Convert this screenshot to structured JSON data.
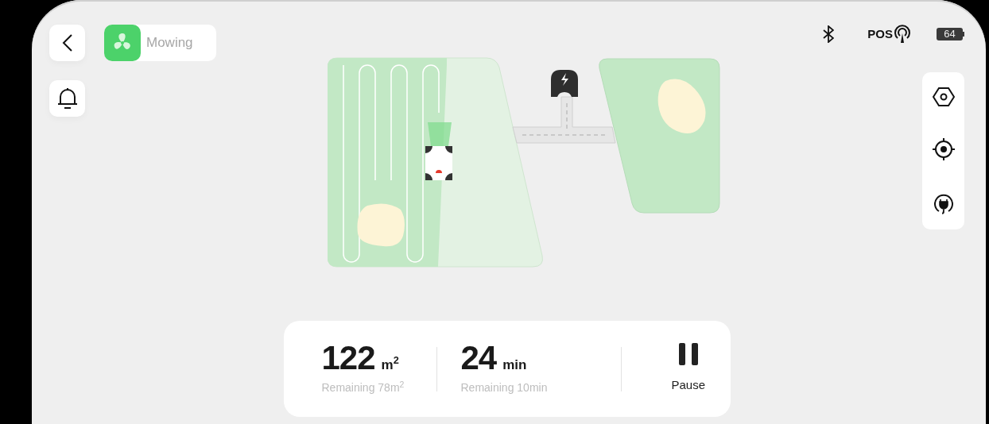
{
  "mode": {
    "label": "Mowing"
  },
  "status_bar": {
    "position_label": "POS",
    "battery": "64"
  },
  "stats": [
    {
      "value": "122",
      "unit": "m$^{2}$",
      "caption": "Remaining 78m$^{2}$"
    },
    {
      "value": "24",
      "unit": "min",
      "caption": "Remaining 10min"
    }
  ],
  "action": {
    "label": "Pause"
  }
}
